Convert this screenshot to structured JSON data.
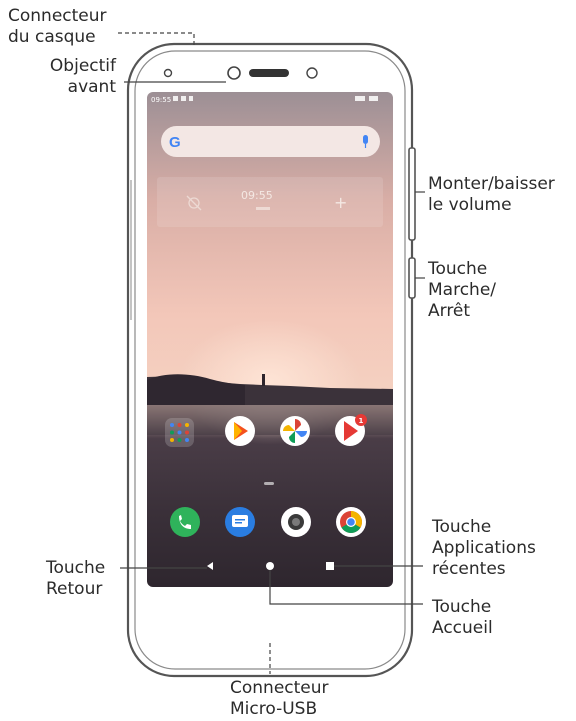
{
  "labels": {
    "headphone": [
      "Connecteur",
      "du casque"
    ],
    "front_camera": [
      "Objectif",
      "avant"
    ],
    "volume": [
      "Monter/baisser",
      "le volume"
    ],
    "power": [
      "Touche",
      "Marche/",
      "Arrêt"
    ],
    "back": [
      "Touche",
      "Retour"
    ],
    "recent": [
      "Touche",
      "Applications",
      "récentes"
    ],
    "home": [
      "Touche",
      "Accueil"
    ],
    "usb": [
      "Connecteur",
      "Micro-USB"
    ]
  },
  "screen": {
    "status_time": "09:55",
    "clock_widget": "09:55",
    "google_letter": "G",
    "notification_badge": "1"
  },
  "colors": {
    "phone_outline": "#555555",
    "leader_line": "#444444",
    "phone_app": "#2fb35b",
    "messages_app": "#2a7de1",
    "chrome_red": "#db4437",
    "chrome_yellow": "#f4b400",
    "chrome_green": "#0f9d58",
    "chrome_blue": "#4285f4"
  }
}
